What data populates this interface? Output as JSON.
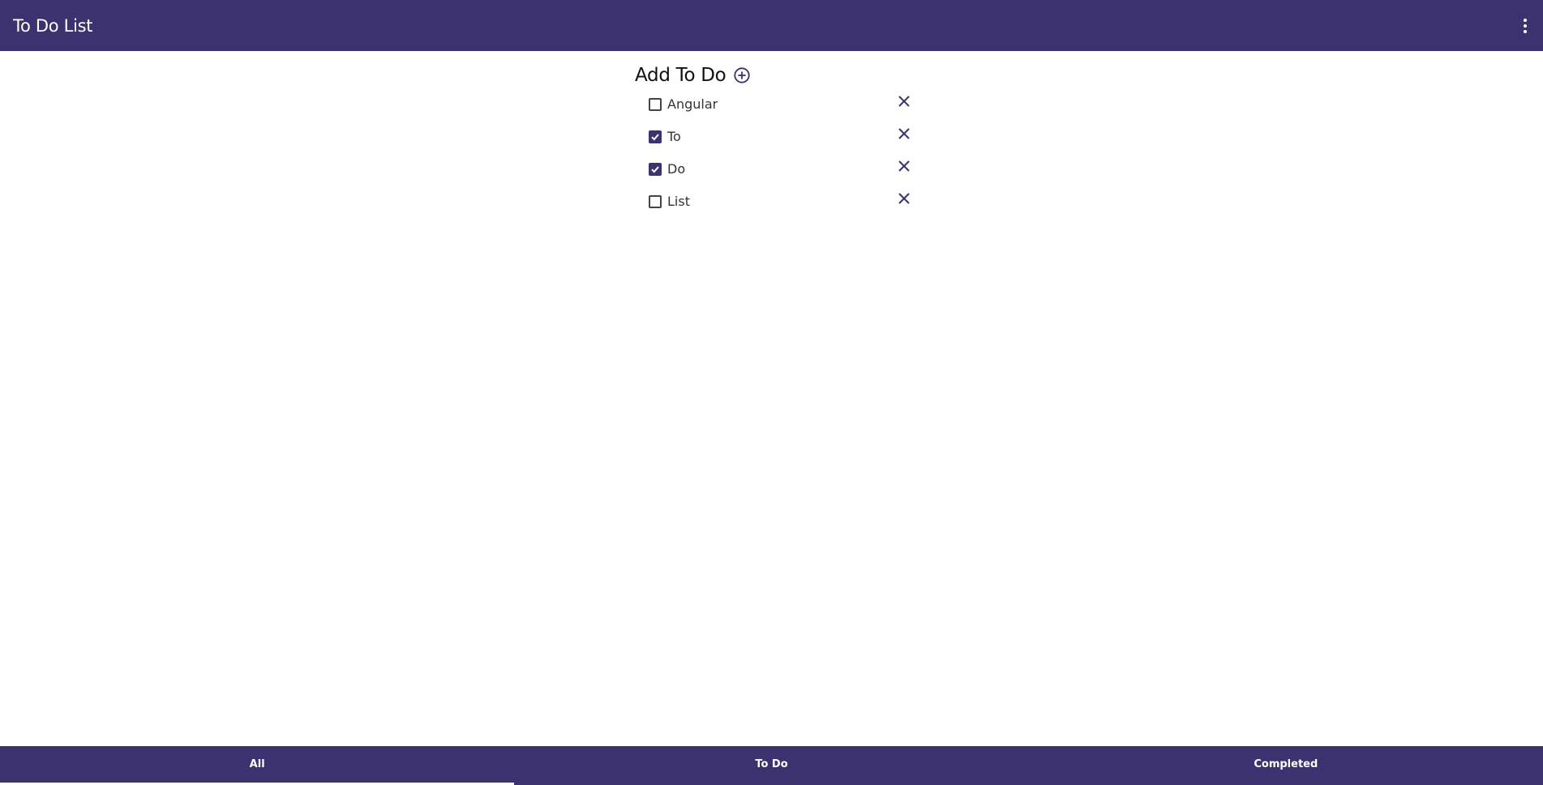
{
  "app": {
    "title": "To Do List",
    "colors": {
      "primary": "#3d3270",
      "background": "#ffffff",
      "on_primary": "#ffffff"
    },
    "menu_icon": "more-vertical-icon"
  },
  "main": {
    "add_title": "Add To Do",
    "add_icon": "add-circle-icon",
    "todos": [
      {
        "label": "Angular",
        "checked": false,
        "delete_icon": "close-icon"
      },
      {
        "label": "To",
        "checked": true,
        "delete_icon": "close-icon"
      },
      {
        "label": "Do",
        "checked": true,
        "delete_icon": "close-icon"
      },
      {
        "label": "List",
        "checked": false,
        "delete_icon": "close-icon"
      }
    ]
  },
  "bottom_nav": {
    "tabs": [
      {
        "label": "All",
        "active": true
      },
      {
        "label": "To Do",
        "active": false
      },
      {
        "label": "Completed",
        "active": false
      }
    ]
  }
}
